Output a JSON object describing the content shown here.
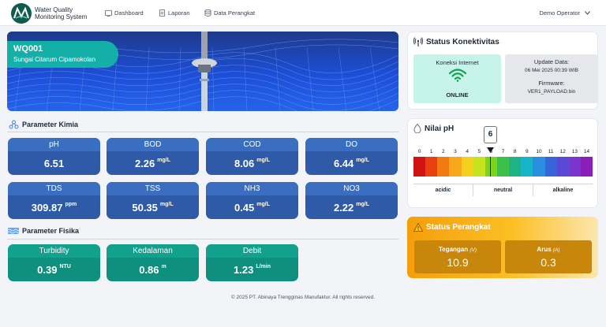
{
  "header": {
    "brand_line1": "Water Quality",
    "brand_line2": "Monitoring System",
    "nav": [
      {
        "label": "Dashboard",
        "icon": "dashboard-icon"
      },
      {
        "label": "Laporan",
        "icon": "report-icon"
      },
      {
        "label": "Data Perangkat",
        "icon": "database-icon"
      }
    ],
    "user": "Demo Operator"
  },
  "hero": {
    "station_id": "WQ001",
    "location": "Sungai Citarum Cipamokolan"
  },
  "kimia": {
    "title": "Parameter Kimia",
    "items": [
      {
        "label": "pH",
        "value": "6.51",
        "unit": ""
      },
      {
        "label": "BOD",
        "value": "2.26",
        "unit": "mg/L"
      },
      {
        "label": "COD",
        "value": "8.06",
        "unit": "mg/L"
      },
      {
        "label": "DO",
        "value": "6.44",
        "unit": "mg/L"
      },
      {
        "label": "TDS",
        "value": "309.87",
        "unit": "ppm"
      },
      {
        "label": "TSS",
        "value": "50.35",
        "unit": "mg/L"
      },
      {
        "label": "NH3",
        "value": "0.45",
        "unit": "mg/L"
      },
      {
        "label": "NO3",
        "value": "2.22",
        "unit": "mg/L"
      }
    ]
  },
  "fisika": {
    "title": "Parameter Fisika",
    "items": [
      {
        "label": "Turbidity",
        "value": "0.39",
        "unit": "NTU"
      },
      {
        "label": "Kedalaman",
        "value": "0.86",
        "unit": "m"
      },
      {
        "label": "Debit",
        "value": "1.23",
        "unit": "L/min"
      }
    ]
  },
  "konektivitas": {
    "title": "Status Konektivitas",
    "internet_label": "Koneksi Internet",
    "internet_status": "ONLINE",
    "update_label": "Update Data:",
    "update_value": "06 Mei 2025 00:39 WIB",
    "firmware_label": "Firmware:",
    "firmware_value": "VER1_PAYLOAD.bin"
  },
  "ph_panel": {
    "title": "Nilai pH",
    "indicator": "6",
    "indicator_value": 6.51,
    "scale": [
      "0",
      "1",
      "2",
      "3",
      "4",
      "5",
      "6",
      "7",
      "8",
      "9",
      "10",
      "11",
      "12",
      "13",
      "14"
    ],
    "colors": [
      "#d11212",
      "#e8410f",
      "#f27a12",
      "#f7a81b",
      "#f5d11e",
      "#c6e31f",
      "#7ed321",
      "#3cc04a",
      "#1fb385",
      "#17b5c7",
      "#2a8fe0",
      "#3566d8",
      "#5a48d6",
      "#7a35cc",
      "#8a1fb8"
    ],
    "categories": [
      "acidic",
      "neutral",
      "alkaline"
    ]
  },
  "perangkat": {
    "title": "Status Perangkat",
    "tegangan_label": "Tegangan",
    "tegangan_unit": "(V)",
    "tegangan_value": "10.9",
    "arus_label": "Arus",
    "arus_unit": "(A)",
    "arus_value": "0.3"
  },
  "footer": "© 2025 PT. Abinaya Trengginas Manufaktur. All rights reserved."
}
